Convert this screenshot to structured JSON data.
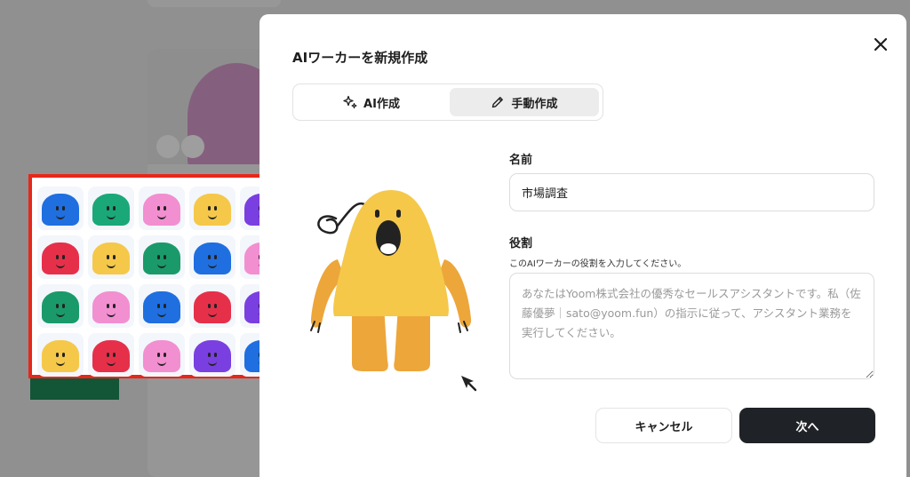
{
  "modal": {
    "title": "AIワーカーを新規作成",
    "tabs": [
      {
        "label": "AI作成",
        "icon": "sparkle-icon",
        "selected": false
      },
      {
        "label": "手動作成",
        "icon": "pencil-icon",
        "selected": true
      }
    ],
    "name": {
      "label": "名前",
      "value": "市場調査"
    },
    "role": {
      "label": "役割",
      "hint": "このAIワーカーの役割を入力してください。",
      "placeholder": "あなたはYoom株式会社の優秀なセールスアシスタントです。私（佐藤優夢｜sato@yoom.fun）の指示に従って、アシスタント業務を実行してください。",
      "value": ""
    },
    "buttons": {
      "cancel": "キャンセル",
      "next": "次へ"
    }
  },
  "colors": {
    "accent_dark": "#1f2226",
    "highlight_border": "#e8261a",
    "mascot_yellow": "#f5c84a",
    "mascot_orange": "#eda63a"
  },
  "sticker_colors": [
    "#1f6fe0",
    "#1aa878",
    "#f28fd0",
    "#f5c84a",
    "#7a3fe0",
    "#e6304a",
    "#f5c84a",
    "#1a9a6a",
    "#1f6fe0",
    "#f28fd0",
    "#1a9a6a",
    "#f28fd0",
    "#1f6fe0",
    "#e6304a",
    "#7a3fe0",
    "#f5c84a",
    "#e6304a",
    "#f28fd0",
    "#7a3fe0",
    "#1f6fe0"
  ]
}
